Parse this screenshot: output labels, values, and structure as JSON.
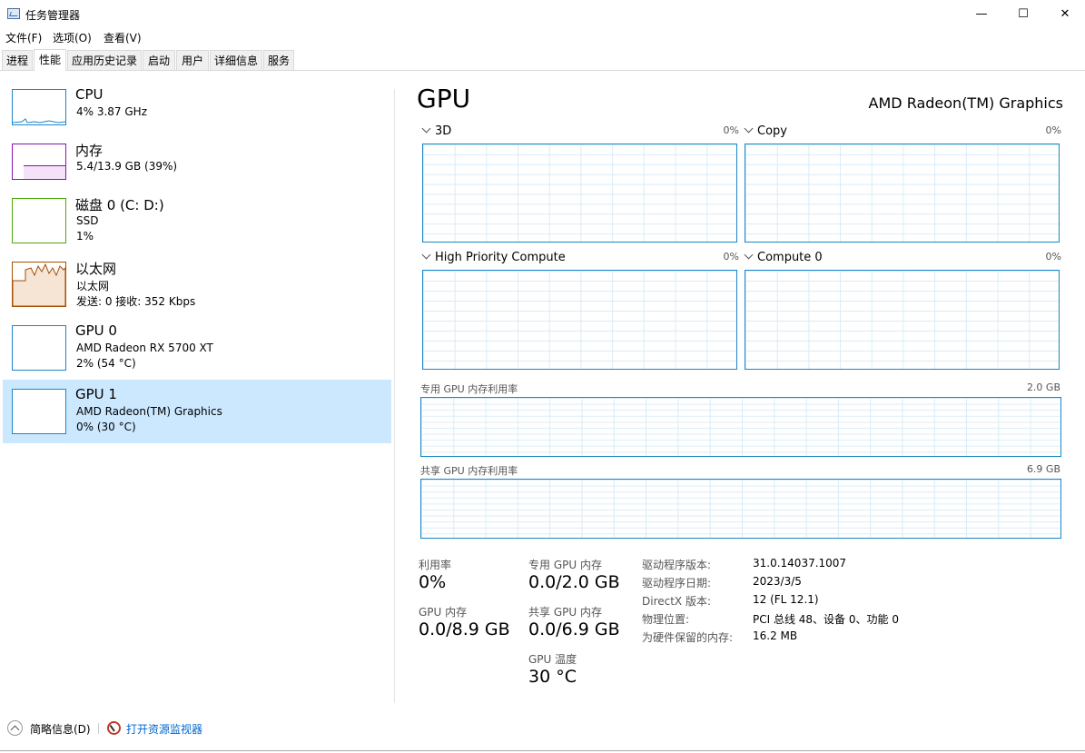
{
  "window": {
    "title": "任务管理器",
    "minimize": "—",
    "maximize": "☐",
    "close": "✕"
  },
  "menu": [
    "文件(F)",
    "选项(O)",
    "查看(V)"
  ],
  "tabs": [
    "进程",
    "性能",
    "应用历史记录",
    "启动",
    "用户",
    "详细信息",
    "服务"
  ],
  "sidebar": [
    {
      "title": "CPU",
      "line1": "4% 3.87 GHz",
      "line2": "",
      "color": "#1a86c8"
    },
    {
      "title": "内存",
      "line1": "5.4/13.9 GB (39%)",
      "line2": "",
      "color": "#8b12ae"
    },
    {
      "title": "磁盘 0 (C: D:)",
      "line1": "SSD",
      "line2": "1%",
      "color": "#4da60c"
    },
    {
      "title": "以太网",
      "line1": "以太网",
      "line2": "发送: 0 接收: 352 Kbps",
      "color": "#a74f01"
    },
    {
      "title": "GPU 0",
      "line1": "AMD Radeon RX 5700 XT",
      "line2": "2% (54 °C)",
      "color": "#1a86c8"
    },
    {
      "title": "GPU 1",
      "line1": "AMD Radeon(TM) Graphics",
      "line2": "0% (30 °C)",
      "color": "#1a86c8"
    }
  ],
  "main": {
    "title": "GPU",
    "device": "AMD Radeon(TM) Graphics",
    "graphs": [
      {
        "label": "3D",
        "pct": "0%"
      },
      {
        "label": "Copy",
        "pct": "0%"
      },
      {
        "label": "High Priority Compute",
        "pct": "0%"
      },
      {
        "label": "Compute 0",
        "pct": "0%"
      }
    ],
    "dedicated_label": "专用 GPU 内存利用率",
    "dedicated_max": "2.0 GB",
    "shared_label": "共享 GPU 内存利用率",
    "shared_max": "6.9 GB"
  },
  "stats": {
    "utilization_label": "利用率",
    "utilization": "0%",
    "dedicated_label": "专用 GPU 内存",
    "dedicated": "0.0/2.0 GB",
    "gpu_mem_label": "GPU 内存",
    "gpu_mem": "0.0/8.9 GB",
    "shared_label": "共享 GPU 内存",
    "shared": "0.0/6.9 GB",
    "temp_label": "GPU 温度",
    "temp": "30 °C"
  },
  "info": [
    {
      "label": "驱动程序版本:",
      "value": "31.0.14037.1007"
    },
    {
      "label": "驱动程序日期:",
      "value": "2023/3/5"
    },
    {
      "label": "DirectX 版本:",
      "value": "12 (FL 12.1)"
    },
    {
      "label": "物理位置:",
      "value": "PCI 总线 48、设备 0、功能 0"
    },
    {
      "label": "为硬件保留的内存:",
      "value": "16.2 MB"
    }
  ],
  "footer": {
    "summary": "简略信息(D)",
    "monitor": "打开资源监视器"
  }
}
